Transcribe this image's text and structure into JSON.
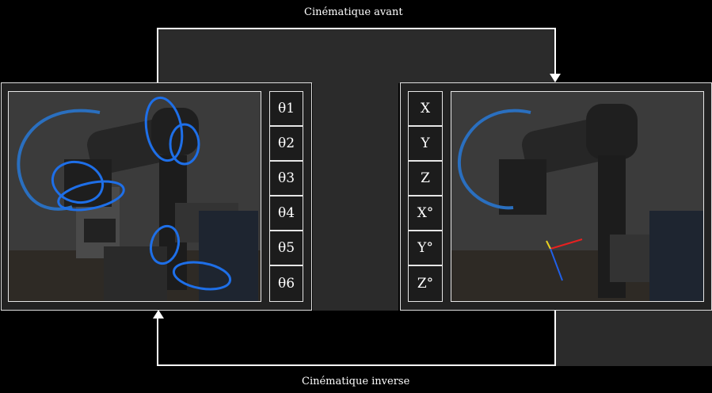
{
  "forward_label": "Cinématique avant",
  "inverse_label": "Cinématique inverse",
  "joints": [
    "θ1",
    "θ2",
    "θ3",
    "θ4",
    "θ5",
    "θ6"
  ],
  "pose": [
    "X",
    "Y",
    "Z",
    "X°",
    "Y°",
    "Z°"
  ]
}
